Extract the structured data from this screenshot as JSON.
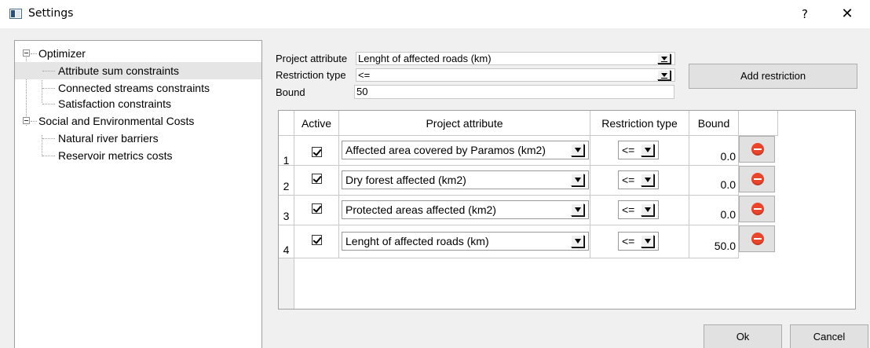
{
  "window": {
    "title": "Settings",
    "help_label": "?",
    "close_label": "✕"
  },
  "tree": {
    "items": [
      {
        "label": "Optimizer",
        "level": 0
      },
      {
        "label": "Attribute sum constraints",
        "level": 1,
        "selected": true
      },
      {
        "label": "Connected streams constraints",
        "level": 1
      },
      {
        "label": "Satisfaction constraints",
        "level": 1
      },
      {
        "label": "Social and Environmental Costs",
        "level": 0
      },
      {
        "label": "Natural river barriers",
        "level": 1
      },
      {
        "label": "Reservoir metrics costs",
        "level": 1
      }
    ]
  },
  "form": {
    "project_attribute_label": "Project attribute",
    "project_attribute_value": "Lenght of affected roads (km)",
    "restriction_type_label": "Restriction type",
    "restriction_type_value": "<=",
    "bound_label": "Bound",
    "bound_value": "50",
    "add_restriction_label": "Add restriction"
  },
  "table": {
    "headers": {
      "active": "Active",
      "attribute": "Project attribute",
      "restriction": "Restriction type",
      "bound": "Bound"
    },
    "rows": [
      {
        "index": "1",
        "active": true,
        "attribute": "Affected area covered by Paramos (km2)",
        "restriction": "<=",
        "bound": "0.0"
      },
      {
        "index": "2",
        "active": true,
        "attribute": "Dry forest affected (km2)",
        "restriction": "<=",
        "bound": "0.0"
      },
      {
        "index": "3",
        "active": true,
        "attribute": "Protected areas affected (km2)",
        "restriction": "<=",
        "bound": "0.0"
      },
      {
        "index": "4",
        "active": true,
        "attribute": "Lenght of affected roads (km)",
        "restriction": "<=",
        "bound": "50.0"
      }
    ]
  },
  "footer": {
    "ok_label": "Ok",
    "cancel_label": "Cancel"
  },
  "colors": {
    "delete_icon": "#e8452c",
    "selection": "#e5e5e5"
  }
}
